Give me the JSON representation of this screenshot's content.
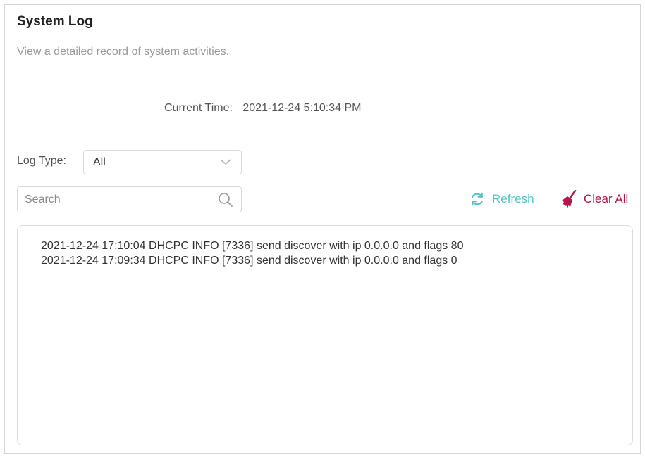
{
  "header": {
    "title": "System Log",
    "description": "View a detailed record of system activities."
  },
  "current_time": {
    "label": "Current Time:",
    "value": "2021-12-24 5:10:34 PM"
  },
  "log_type": {
    "label": "Log Type:",
    "selected": "All"
  },
  "search": {
    "placeholder": "Search",
    "value": ""
  },
  "actions": {
    "refresh_label": "Refresh",
    "clear_label": "Clear All"
  },
  "logs": [
    "2021-12-24 17:10:04 DHCPC INFO [7336] send discover with ip 0.0.0.0 and flags 80",
    "2021-12-24 17:09:34 DHCPC INFO [7336] send discover with ip 0.0.0.0 and flags 0"
  ],
  "colors": {
    "accent_refresh": "#52c5c8",
    "accent_clear": "#b3174e"
  },
  "icons": {
    "chevron": "chevron-down-icon",
    "search": "search-icon",
    "refresh": "refresh-icon",
    "clear": "broom-icon"
  }
}
